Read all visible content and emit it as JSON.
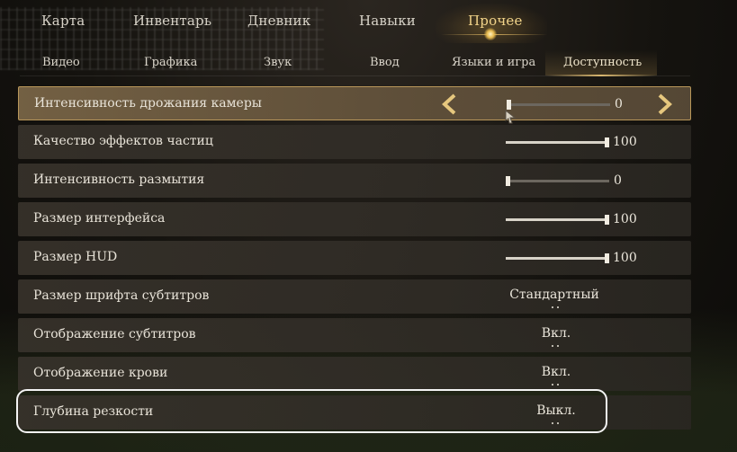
{
  "top_tabs": [
    {
      "label": "Карта"
    },
    {
      "label": "Инвентарь"
    },
    {
      "label": "Дневник"
    },
    {
      "label": "Навыки"
    },
    {
      "label": "Прочее"
    }
  ],
  "top_tab_active": "Прочее",
  "sub_tabs": [
    {
      "label": "Видео"
    },
    {
      "label": "Графика"
    },
    {
      "label": "Звук"
    },
    {
      "label": "Ввод"
    },
    {
      "label": "Языки и игра"
    },
    {
      "label": "Доступность"
    }
  ],
  "sub_tab_active": "Доступность",
  "settings": [
    {
      "label": "Интенсивность дрожания камеры",
      "type": "slider",
      "value": "0",
      "level": 0,
      "selected": true
    },
    {
      "label": "Качество эффектов частиц",
      "type": "slider",
      "value": "100",
      "level": 100
    },
    {
      "label": "Интенсивность размытия",
      "type": "slider",
      "value": "0",
      "level": 0
    },
    {
      "label": "Размер интерфейса",
      "type": "slider",
      "value": "100",
      "level": 100
    },
    {
      "label": "Размер HUD",
      "type": "slider",
      "value": "100",
      "level": 100
    },
    {
      "label": "Размер шрифта субтитров",
      "type": "select",
      "value": "Стандартный"
    },
    {
      "label": "Отображение субтитров",
      "type": "select",
      "value": "Вкл."
    },
    {
      "label": "Отображение крови",
      "type": "select",
      "value": "Вкл."
    },
    {
      "label": "Глубина резкости",
      "type": "select",
      "value": "Выкл.",
      "focused": true
    }
  ],
  "icons": {
    "left_arrow": "chevron-left-icon",
    "right_arrow": "chevron-right-icon",
    "cursor": "mouse-cursor-icon"
  },
  "colors": {
    "accent_gold": "#f2d48a",
    "selected_border": "#b9975a",
    "arrow_gold": "#e6c77e"
  }
}
